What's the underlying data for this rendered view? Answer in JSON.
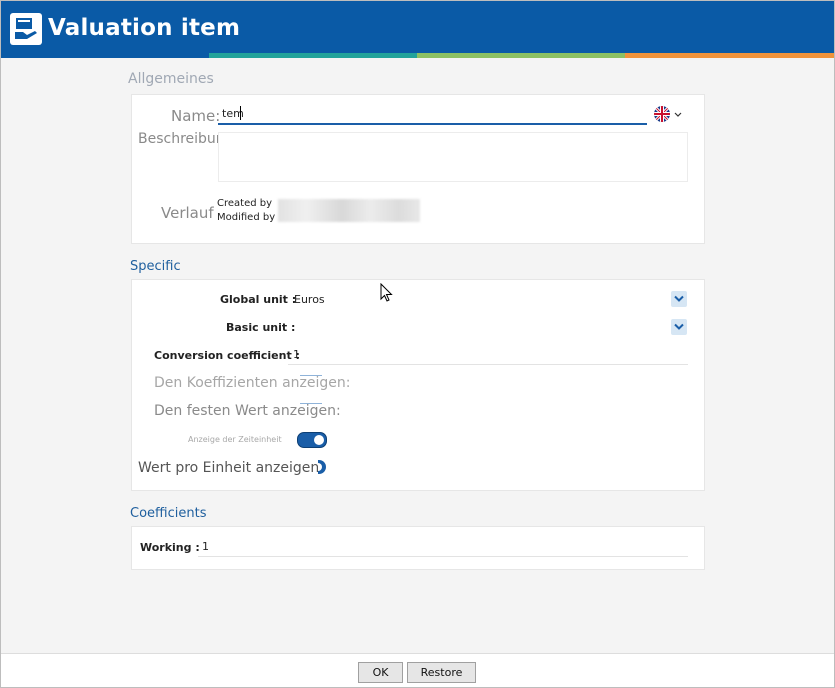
{
  "window": {
    "title": "Valuation item"
  },
  "general": {
    "section_title": "Allgemeines",
    "name_label": "Name:",
    "name_value": "tem",
    "language_flag": "uk-flag-icon",
    "description_label": "Beschreibung:",
    "description_value": "",
    "history_label": "Verlauf",
    "created_by_label": "Created by",
    "modified_by_label": "Modified by"
  },
  "specific": {
    "section_title": "Specific",
    "global_unit_label": "Global unit :",
    "global_unit_value": "Euros",
    "basic_unit_label": "Basic unit :",
    "basic_unit_value": "",
    "conversion_label": "Conversion coefficient :",
    "conversion_value": "1",
    "show_coefficients_label": "Den Koeffizienten anzeigen:",
    "show_fixed_value_label": "Den festen Wert anzeigen:",
    "time_unit_label": "Anzeige der Zeiteinheit",
    "time_unit_on": true,
    "value_per_unit_label": "Wert pro Einheit anzeigen:"
  },
  "coefficients": {
    "section_title": "Coefficients",
    "working_label": "Working :",
    "working_value": "1"
  },
  "footer": {
    "ok_label": "OK",
    "restore_label": "Restore"
  },
  "colors": {
    "brand": "#0a5aa6",
    "section_title": "#1f5f9e",
    "toggle": "#1a5ea8"
  }
}
